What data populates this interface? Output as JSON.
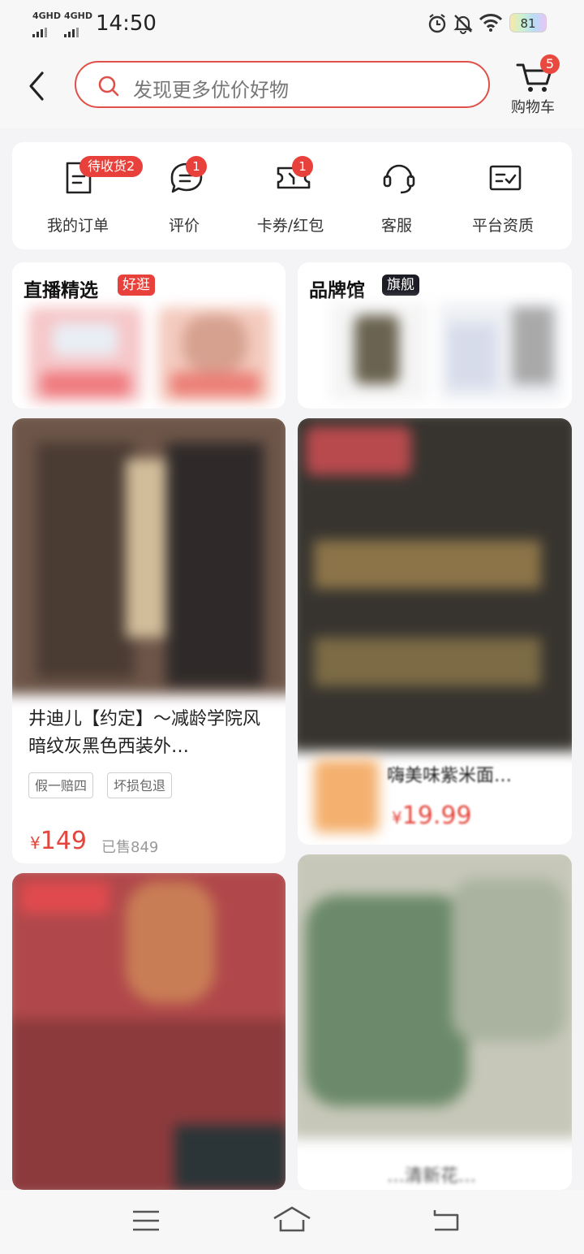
{
  "status_bar": {
    "sim1": "4GHD",
    "sim2": "4GHD",
    "time": "14:50",
    "battery": "81",
    "icons": [
      "alarm-icon",
      "bell-off-icon",
      "wifi-icon",
      "battery-icon"
    ]
  },
  "header": {
    "search_placeholder": "发现更多优价好物",
    "cart_label": "购物车",
    "cart_count": "5"
  },
  "menu": {
    "items": [
      {
        "label": "我的订单",
        "badge": "待收货2",
        "icon": "order-icon"
      },
      {
        "label": "评价",
        "badge": "1",
        "icon": "comment-icon"
      },
      {
        "label": "卡券/红包",
        "badge": "1",
        "icon": "coupon-icon"
      },
      {
        "label": "客服",
        "badge": "",
        "icon": "headset-icon"
      },
      {
        "label": "平台资质",
        "badge": "",
        "icon": "certificate-icon"
      }
    ]
  },
  "sections": {
    "live": {
      "title": "直播精选",
      "tag": "好逛"
    },
    "brand": {
      "title": "品牌馆",
      "tag": "旗舰"
    }
  },
  "products": [
    {
      "title": "井迪儿【约定】～减龄学院风暗纹灰黑色西装外…",
      "chips": [
        "假一赔四",
        "坏损包退"
      ],
      "price_symbol": "¥",
      "price": "149",
      "sold": "已售849"
    },
    {
      "title": "嗨美味紫米面…",
      "price_symbol": "¥",
      "price": "19.99"
    },
    {
      "title": "",
      "price": ""
    },
    {
      "title": "…清新花…",
      "price": ""
    }
  ],
  "colors": {
    "accent": "#e8403a",
    "price": "#e4463d"
  }
}
